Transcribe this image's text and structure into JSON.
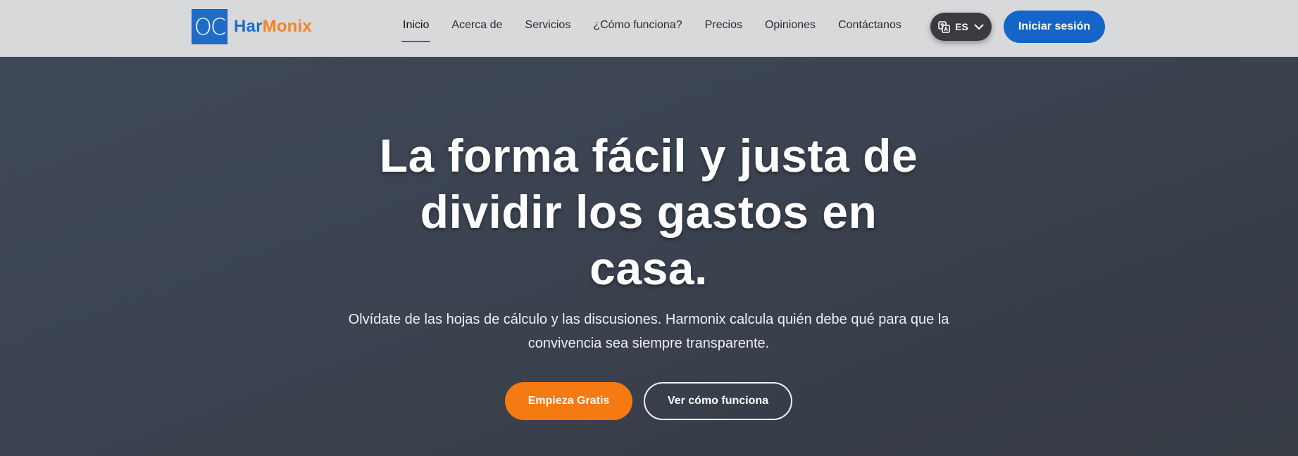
{
  "header": {
    "logo": {
      "mark": "OC",
      "name_part1": "Har",
      "name_part2": "Monix",
      "colors": {
        "part1": "#1f6cc7",
        "part2": "#f58220"
      }
    },
    "nav": [
      {
        "label": "Inicio",
        "active": true
      },
      {
        "label": "Acerca de"
      },
      {
        "label": "Servicios"
      },
      {
        "label": "¿Cómo funciona?"
      },
      {
        "label": "Precios"
      },
      {
        "label": "Opiniones"
      },
      {
        "label": "Contáctanos"
      }
    ],
    "language": {
      "code": "ES",
      "icon": "translate-icon"
    },
    "login_label": "Iniciar sesión"
  },
  "hero": {
    "title_lines": [
      "La forma fácil y justa de",
      "dividir los gastos en",
      "casa."
    ],
    "subtitle_lines": [
      "Olvídate de las hojas de cálculo y las discusiones. Harmonix calcula quién debe qué para que la",
      "convivencia sea siempre transparente."
    ],
    "cta_primary": "Empieza Gratis",
    "cta_secondary": "Ver cómo funciona"
  },
  "colors": {
    "accent_blue": "#1565c8",
    "accent_orange": "#f57a12",
    "header_bg": "#d8d9db",
    "hero_bg": "#3c4452"
  }
}
